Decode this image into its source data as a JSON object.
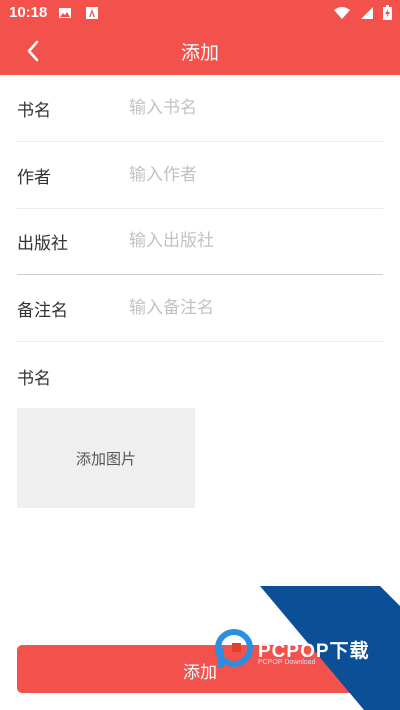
{
  "status_bar": {
    "time": "10:18",
    "left_icons": [
      "image-icon",
      "app-a-icon"
    ],
    "right_icons": [
      "wifi-icon",
      "signal-icon",
      "battery-icon"
    ]
  },
  "app_bar": {
    "title": "添加",
    "back_icon": "chevron-left-icon",
    "color": "#f2514c"
  },
  "form": {
    "fields": [
      {
        "label": "书名",
        "placeholder": "输入书名",
        "value": ""
      },
      {
        "label": "作者",
        "placeholder": "输入作者",
        "value": ""
      },
      {
        "label": "出版社",
        "placeholder": "输入出版社",
        "value": ""
      },
      {
        "label": "备注名",
        "placeholder": "输入备注名",
        "value": ""
      }
    ],
    "image_section_label": "书名",
    "add_image_label": "添加图片",
    "submit_label": "添加"
  },
  "watermark": {
    "text": "PCPOP下载",
    "sub": "PCPOP Download"
  }
}
